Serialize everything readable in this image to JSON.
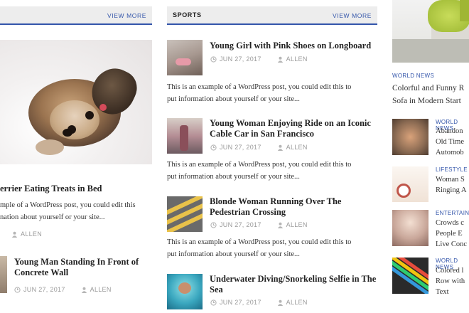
{
  "left": {
    "view_more": "VIEW MORE",
    "featured": {
      "title_partial": "errier Eating Treats in Bed",
      "excerpt_line1": "mple of a WordPress post, you could edit this",
      "excerpt_line2": "nation about yourself or your site...",
      "author": "ALLEN"
    },
    "item": {
      "title": "Young Man Standing In Front of Concrete Wall",
      "date": "JUN 27, 2017",
      "author": "ALLEN"
    }
  },
  "sports": {
    "label": "SPORTS",
    "view_more": "VIEW MORE",
    "posts": [
      {
        "title": "Young Girl with Pink Shoes on Longboard",
        "date": "JUN 27, 2017",
        "author": "ALLEN",
        "excerpt_line1": "This is an example of a WordPress post, you could edit this to",
        "excerpt_line2": "put information about yourself or your site..."
      },
      {
        "title": "Young Woman Enjoying Ride on an Iconic Cable Car in San Francisco",
        "date": "JUN 27, 2017",
        "author": "ALLEN",
        "excerpt_line1": "This is an example of a WordPress post, you could edit this to",
        "excerpt_line2": "put information about yourself or your site..."
      },
      {
        "title": "Blonde Woman Running Over The Pedestrian Crossing",
        "date": "JUN 27, 2017",
        "author": "ALLEN",
        "excerpt_line1": "This is an example of a WordPress post, you could edit this to",
        "excerpt_line2": "put information about yourself or your site..."
      },
      {
        "title": "Underwater Diving/Snorkeling Selfie in The Sea",
        "date": "JUN 27, 2017",
        "author": "ALLEN"
      }
    ]
  },
  "right": {
    "featured": {
      "category": "WORLD NEWS",
      "title_line1": "Colorful and Funny R",
      "title_line2": "Sofa in Modern Start"
    },
    "items": [
      {
        "category": "WORLD NEWS",
        "l1": "Abandon",
        "l2": "Old Time",
        "l3": "Automob"
      },
      {
        "category": "LIFESTYLE",
        "l1": "Woman S",
        "l2": "Ringing A"
      },
      {
        "category": "ENTERTAINM",
        "l1": "Crowds c",
        "l2": "People E",
        "l3": "Live Conc"
      },
      {
        "category": "WORLD NEWS",
        "l1": "Colored l",
        "l2": "Row with",
        "l3": "Text"
      }
    ]
  },
  "colors": {
    "accent": "#3355aa",
    "header_bg": "#ededed",
    "meta": "#9a9a9a"
  },
  "icons": {
    "date": "clock-icon",
    "author": "user-icon"
  }
}
